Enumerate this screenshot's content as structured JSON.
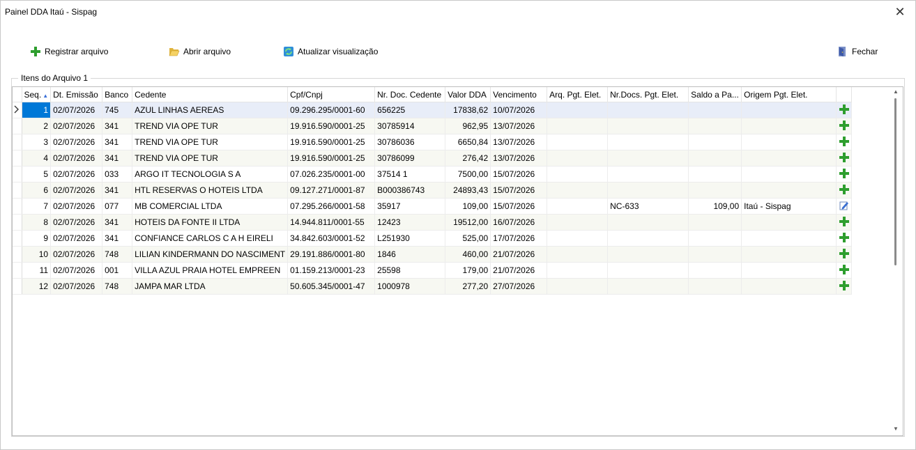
{
  "window": {
    "title": "Painel DDA Itaú - Sispag",
    "close_glyph": "✕"
  },
  "toolbar": {
    "register": "Registrar arquivo",
    "open": "Abrir arquivo",
    "refresh": "Atualizar visualização",
    "close": "Fechar"
  },
  "group": {
    "label": "Itens do Arquivo 1"
  },
  "columns": [
    "Seq.",
    "Dt. Emissão",
    "Banco",
    "Cedente",
    "Cpf/Cnpj",
    "Nr. Doc. Cedente",
    "Valor DDA",
    "Vencimento",
    "Arq. Pgt. Elet.",
    "Nr.Docs. Pgt. Elet.",
    "Saldo a Pa...",
    "Origem Pgt. Elet."
  ],
  "rows": [
    {
      "seq": "1",
      "emissao": "02/07/2026",
      "banco": "745",
      "cedente": "AZUL LINHAS AEREAS",
      "cnpj": "09.296.295/0001-60",
      "doc": "656225",
      "valor": "17838,62",
      "venc": "10/07/2026",
      "arq": "",
      "nrdocs": "",
      "saldo": "",
      "origem": "",
      "action": "add-icon"
    },
    {
      "seq": "2",
      "emissao": "02/07/2026",
      "banco": "341",
      "cedente": "TREND VIA OPE TUR",
      "cnpj": "19.916.590/0001-25",
      "doc": "30785914",
      "valor": "962,95",
      "venc": "13/07/2026",
      "arq": "",
      "nrdocs": "",
      "saldo": "",
      "origem": "",
      "action": "add-icon"
    },
    {
      "seq": "3",
      "emissao": "02/07/2026",
      "banco": "341",
      "cedente": "TREND VIA OPE TUR",
      "cnpj": "19.916.590/0001-25",
      "doc": "30786036",
      "valor": "6650,84",
      "venc": "13/07/2026",
      "arq": "",
      "nrdocs": "",
      "saldo": "",
      "origem": "",
      "action": "add-icon"
    },
    {
      "seq": "4",
      "emissao": "02/07/2026",
      "banco": "341",
      "cedente": "TREND VIA OPE TUR",
      "cnpj": "19.916.590/0001-25",
      "doc": "30786099",
      "valor": "276,42",
      "venc": "13/07/2026",
      "arq": "",
      "nrdocs": "",
      "saldo": "",
      "origem": "",
      "action": "add-icon"
    },
    {
      "seq": "5",
      "emissao": "02/07/2026",
      "banco": "033",
      "cedente": "ARGO IT TECNOLOGIA S A",
      "cnpj": "07.026.235/0001-00",
      "doc": "37514 1",
      "valor": "7500,00",
      "venc": "15/07/2026",
      "arq": "",
      "nrdocs": "",
      "saldo": "",
      "origem": "",
      "action": "add-icon"
    },
    {
      "seq": "6",
      "emissao": "02/07/2026",
      "banco": "341",
      "cedente": "HTL RESERVAS O HOTEIS LTDA",
      "cnpj": "09.127.271/0001-87",
      "doc": "B000386743",
      "valor": "24893,43",
      "venc": "15/07/2026",
      "arq": "",
      "nrdocs": "",
      "saldo": "",
      "origem": "",
      "action": "add-icon"
    },
    {
      "seq": "7",
      "emissao": "02/07/2026",
      "banco": "077",
      "cedente": "MB COMERCIAL LTDA",
      "cnpj": "07.295.266/0001-58",
      "doc": "35917",
      "valor": "109,00",
      "venc": "15/07/2026",
      "arq": "",
      "nrdocs": "NC-633",
      "saldo": "109,00",
      "origem": "Itaú - Sispag",
      "action": "edit-icon"
    },
    {
      "seq": "8",
      "emissao": "02/07/2026",
      "banco": "341",
      "cedente": "HOTEIS DA FONTE II LTDA",
      "cnpj": "14.944.811/0001-55",
      "doc": "12423",
      "valor": "19512,00",
      "venc": "16/07/2026",
      "arq": "",
      "nrdocs": "",
      "saldo": "",
      "origem": "",
      "action": "add-icon"
    },
    {
      "seq": "9",
      "emissao": "02/07/2026",
      "banco": "341",
      "cedente": "CONFIANCE CARLOS C A H EIRELI",
      "cnpj": "34.842.603/0001-52",
      "doc": "L251930",
      "valor": "525,00",
      "venc": "17/07/2026",
      "arq": "",
      "nrdocs": "",
      "saldo": "",
      "origem": "",
      "action": "add-icon"
    },
    {
      "seq": "10",
      "emissao": "02/07/2026",
      "banco": "748",
      "cedente": "LILIAN KINDERMANN DO NASCIMENT",
      "cnpj": "29.191.886/0001-80",
      "doc": "1846",
      "valor": "460,00",
      "venc": "21/07/2026",
      "arq": "",
      "nrdocs": "",
      "saldo": "",
      "origem": "",
      "action": "add-icon"
    },
    {
      "seq": "11",
      "emissao": "02/07/2026",
      "banco": "001",
      "cedente": "VILLA AZUL PRAIA HOTEL EMPREEN",
      "cnpj": "01.159.213/0001-23",
      "doc": "25598",
      "valor": "179,00",
      "venc": "21/07/2026",
      "arq": "",
      "nrdocs": "",
      "saldo": "",
      "origem": "",
      "action": "add-icon"
    },
    {
      "seq": "12",
      "emissao": "02/07/2026",
      "banco": "748",
      "cedente": "JAMPA MAR LTDA",
      "cnpj": "50.605.345/0001-47",
      "doc": "1000978",
      "valor": "277,20",
      "venc": "27/07/2026",
      "arq": "",
      "nrdocs": "",
      "saldo": "",
      "origem": "",
      "action": "add-icon"
    }
  ],
  "selected_row": 0,
  "colors": {
    "selection": "#0078d7",
    "add_green": "#2e9e2e",
    "alt_row": "#f7f8f2"
  }
}
